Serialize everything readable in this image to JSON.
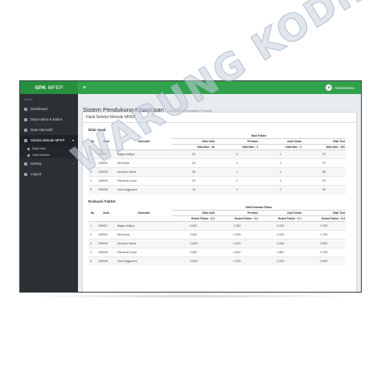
{
  "topbar": {
    "brand_bold": "SPK",
    "brand_rest": "MFEP",
    "menu_icon": "hamburger-icon",
    "user_name": "Administrator"
  },
  "sidebar": {
    "section_label": "MENU",
    "items": [
      {
        "label": "Dashboard",
        "icon": "dashboard-icon"
      },
      {
        "label": "Data Faktor & Bobot",
        "icon": "list-icon"
      },
      {
        "label": "Data Alternatif",
        "icon": "users-icon"
      },
      {
        "label": "Seleksi Metode MFEP",
        "icon": "table-icon"
      },
      {
        "label": "Setting",
        "icon": "gear-icon"
      },
      {
        "label": "Logout",
        "icon": "logout-icon"
      }
    ],
    "subitems": [
      {
        "label": "Data Nilai"
      },
      {
        "label": "Hasil Seleksi"
      }
    ]
  },
  "page": {
    "title": "Sistem Pendukung Keputusan",
    "subtitle": "Multifactor Evaluation Process",
    "panel_title": "Hasil Seleksi Metode MFEP"
  },
  "table1": {
    "title": "Nilai Awal",
    "group_header": "Nilai Faktor",
    "headers": [
      "No",
      "Nodi",
      "Alternatif",
      "Nilai UAN",
      "Prestasi",
      "Asal Siswa",
      "Nilai Test"
    ],
    "subheaders": [
      "Nilai Max : 30",
      "Nilai Max : 3",
      "Nilai Max : 3",
      "Nilai Max : 100"
    ],
    "rows": [
      [
        "1",
        "159001",
        "Bagus Aditya",
        "20",
        "3",
        "1",
        "75"
      ],
      [
        "2",
        "159002",
        "Siti Anisa",
        "20",
        "1",
        "1",
        "75"
      ],
      [
        "3",
        "159003",
        "Annisya Zahra",
        "25",
        "1",
        "1",
        "85"
      ],
      [
        "4",
        "159004",
        "Pambudi Luhur",
        "20",
        "2",
        "2",
        "75"
      ],
      [
        "5",
        "159005",
        "Devi Anggraeni",
        "15",
        "1",
        "1",
        "90"
      ]
    ]
  },
  "table2": {
    "title": "Evaluasi Faktor",
    "group_header": "Nilai Evaluasi Faktor",
    "headers": [
      "No",
      "Nodi",
      "Alternatif",
      "Nilai UAN",
      "Prestasi",
      "Asal Siswa",
      "Nilai Test"
    ],
    "subheaders": [
      "Bobot Faktor : 0,4",
      "Bobot Faktor : 0,2",
      "Bobot Faktor : 0,1",
      "Bobot Faktor : 0,3"
    ],
    "rows": [
      [
        "1",
        "159001",
        "Bagus Aditya",
        "0,667",
        "1,000",
        "0,333",
        "0,750"
      ],
      [
        "2",
        "159002",
        "Siti Anisa",
        "0,667",
        "0,333",
        "0,333",
        "0,750"
      ],
      [
        "3",
        "159003",
        "Annisya Zahra",
        "0,833",
        "0,333",
        "0,333",
        "0,850"
      ],
      [
        "4",
        "159004",
        "Pambudi Luhur",
        "0,667",
        "0,667",
        "0,667",
        "0,750"
      ],
      [
        "5",
        "159005",
        "Devi Anggraeni",
        "0,500",
        "0,333",
        "0,333",
        "0,900"
      ]
    ]
  },
  "watermark": "WARUNG KODING",
  "colors": {
    "topbar": "#2fa24b",
    "sidebar": "#2b3035"
  }
}
